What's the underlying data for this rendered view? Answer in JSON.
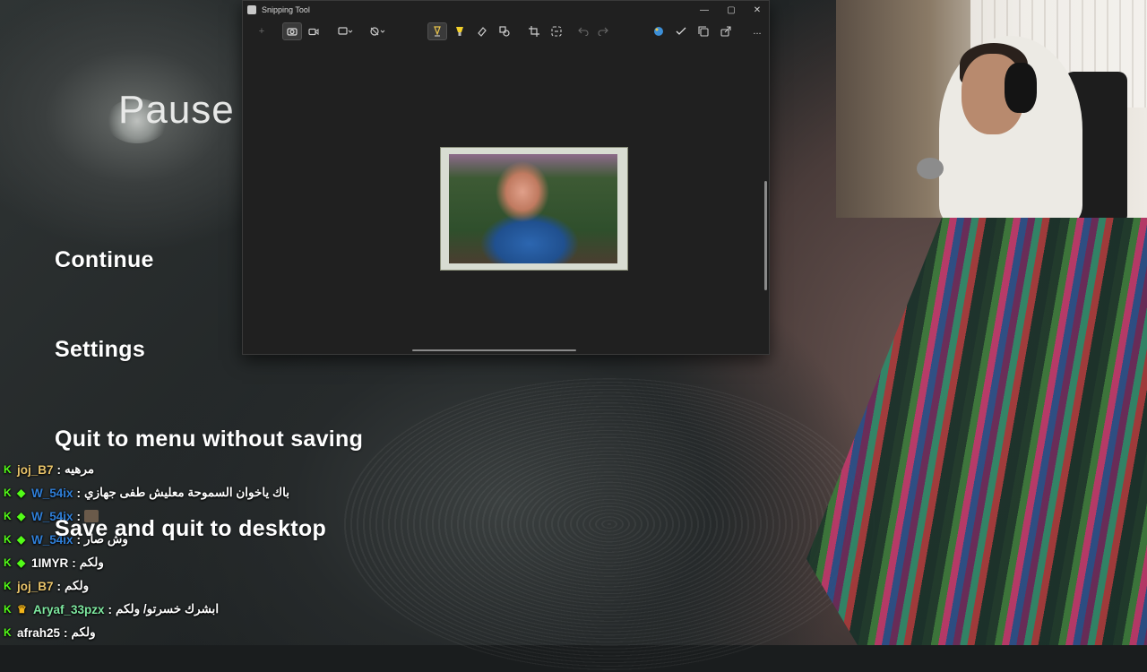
{
  "game_menu": {
    "title": "Pause",
    "items": [
      {
        "label": "Continue"
      },
      {
        "label": "Settings"
      },
      {
        "label": "Quit to menu without saving"
      },
      {
        "label": "Save and quit to desktop"
      }
    ]
  },
  "snipping_tool": {
    "title": "Snipping Tool",
    "toolbar": {
      "new": "+",
      "screenshot_mode": "camera-icon",
      "video_mode": "video-icon",
      "shape": "rectangle-snip-icon",
      "delay": "no-delay-icon",
      "ballpoint": "pen-icon",
      "highlighter": "highlighter-icon",
      "eraser": "eraser-icon",
      "shapes": "shapes-icon",
      "crop": "crop-icon",
      "text_actions": "text-actions-icon",
      "undo": "undo-icon",
      "redo": "redo-icon",
      "paint3d": "paint-icon",
      "save": "check-icon",
      "copy": "copy-icon",
      "share": "share-icon",
      "more": "..."
    },
    "window_controls": {
      "minimize": "—",
      "maximize": "▢",
      "close": "✕"
    }
  },
  "chat": [
    {
      "user": "joj_B7",
      "color": "#e9c46a",
      "badges": [
        "kick"
      ],
      "message": "مرهيه"
    },
    {
      "user": "W_54ix",
      "color": "#2f7fd8",
      "badges": [
        "kick",
        "diamond"
      ],
      "message": "باك ياخوان السموحة معليش طفى جهازي"
    },
    {
      "user": "W_54ix",
      "color": "#2f7fd8",
      "badges": [
        "kick",
        "diamond"
      ],
      "message": "",
      "emote": true
    },
    {
      "user": "W_54ix",
      "color": "#2f7fd8",
      "badges": [
        "kick",
        "diamond"
      ],
      "message": "وش صار"
    },
    {
      "user": "1IMYR",
      "color": "#ffffff",
      "badges": [
        "kick",
        "diamond"
      ],
      "message": "ولكم"
    },
    {
      "user": "joj_B7",
      "color": "#e9c46a",
      "badges": [
        "kick"
      ],
      "message": "ولكم"
    },
    {
      "user": "Aryaf_33pzx",
      "color": "#7ee8a0",
      "badges": [
        "kick",
        "crown"
      ],
      "message": "ابشرك خسرتو/ ولكم"
    },
    {
      "user": "afrah25",
      "color": "#ffffff",
      "badges": [
        "kick"
      ],
      "message": "ولكم"
    }
  ]
}
